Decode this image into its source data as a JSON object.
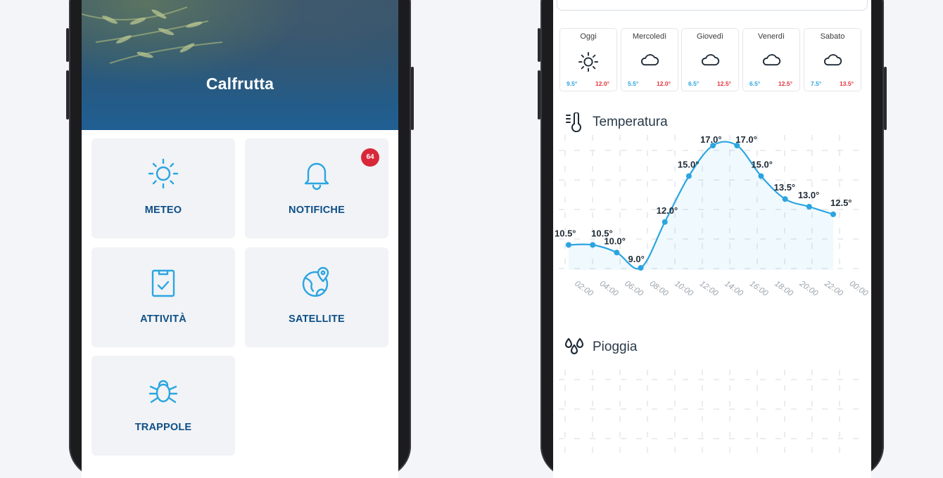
{
  "left_app": {
    "hero_title": "Calfrutta",
    "tiles": [
      {
        "label": "METEO",
        "icon": "sun-icon"
      },
      {
        "label": "NOTIFICHE",
        "icon": "bell-icon",
        "badge": "64"
      },
      {
        "label": "ATTIVITÀ",
        "icon": "clipboard-check-icon"
      },
      {
        "label": "SATELLITE",
        "icon": "globe-pin-icon"
      },
      {
        "label": "TRAPPOLE",
        "icon": "bug-icon"
      }
    ]
  },
  "right_app": {
    "forecast": [
      {
        "day": "Oggi",
        "icon": "sun-icon",
        "min": "9.5°",
        "max": "12.0°"
      },
      {
        "day": "Mercoledì",
        "icon": "cloud-icon",
        "min": "5.5°",
        "max": "12.0°"
      },
      {
        "day": "Giovedì",
        "icon": "cloud-icon",
        "min": "6.5°",
        "max": "12.5°"
      },
      {
        "day": "Venerdì",
        "icon": "cloud-icon",
        "min": "6.5°",
        "max": "12.5°"
      },
      {
        "day": "Sabato",
        "icon": "cloud-icon",
        "min": "7.5°",
        "max": "13.5°"
      }
    ],
    "temperature_title": "Temperatura",
    "rain_title": "Pioggia"
  },
  "colors": {
    "primary": "#0e4f86",
    "accent": "#2ba5e1",
    "badge": "#d8283a",
    "max_temp": "#e5313a",
    "min_temp": "#2ba5e1"
  },
  "chart_data": {
    "type": "line",
    "title": "Temperatura",
    "x": [
      "00:00",
      "02:00",
      "04:00",
      "06:00",
      "08:00",
      "10:00",
      "12:00",
      "14:00",
      "16:00",
      "18:00",
      "20:00",
      "22:00"
    ],
    "series": [
      {
        "values": [
          10.5,
          10.5,
          10.0,
          9.0,
          12.0,
          15.0,
          17.0,
          17.0,
          15.0,
          13.5,
          13.0,
          12.5
        ]
      }
    ],
    "value_labels": [
      "10.5°",
      "10.5°",
      "10.0°",
      "9.0°",
      "12.0°",
      "15.0°",
      "17.0°",
      "17.0°",
      "15.0°",
      "13.5°",
      "13.0°",
      "12.5°"
    ],
    "tick_labels": [
      "02:00",
      "04:00",
      "06:00",
      "08:00",
      "10:00",
      "12:00",
      "14:00",
      "16:00",
      "18:00",
      "20:00",
      "22:00",
      "00:00"
    ],
    "ylim": [
      9,
      17
    ],
    "grid": true
  }
}
